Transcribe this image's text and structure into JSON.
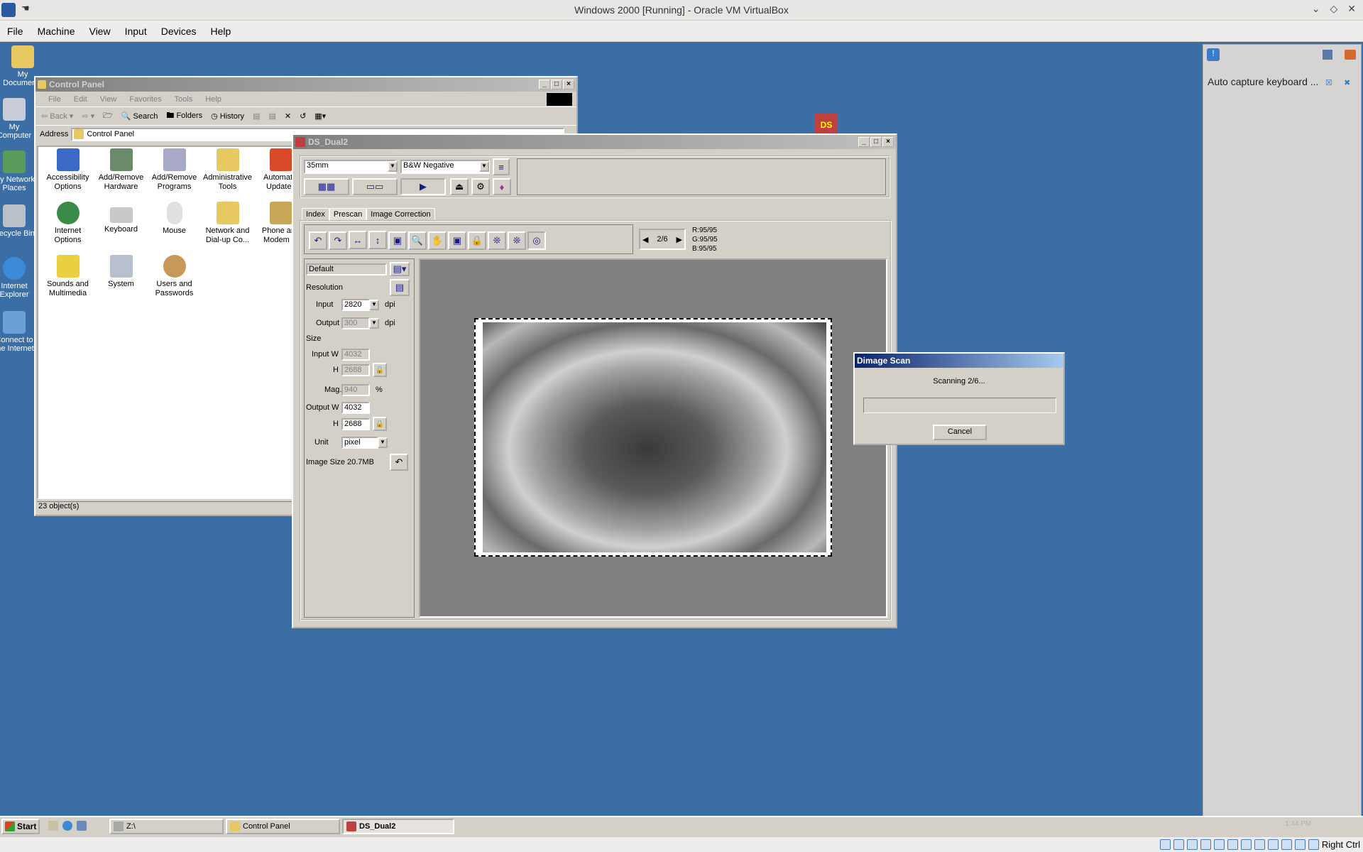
{
  "host": {
    "title": "Windows 2000 [Running] - Oracle VM VirtualBox",
    "menu": [
      "File",
      "Machine",
      "View",
      "Input",
      "Devices",
      "Help"
    ],
    "status_key": "Right Ctrl"
  },
  "side_panel": {
    "notification": "Auto capture keyboard ..."
  },
  "desktop_icons": [
    "My Documents",
    "My Computer",
    "My Network Places",
    "Recycle Bin",
    "Internet Explorer",
    "Connect to the Internet"
  ],
  "control_panel": {
    "title": "Control Panel",
    "menu": [
      "File",
      "Edit",
      "View",
      "Favorites",
      "Tools",
      "Help"
    ],
    "toolbar": {
      "back": "Back",
      "search": "Search",
      "folders": "Folders",
      "history": "History"
    },
    "address_label": "Address",
    "address_value": "Control Panel",
    "items": [
      "Accessibility Options",
      "Add/Remove Hardware",
      "Add/Remove Programs",
      "Administrative Tools",
      "Automatic Updates",
      "Internet Options",
      "Keyboard",
      "Mouse",
      "Network and Dial-up Co...",
      "Phone and Modem ...",
      "Sounds and Multimedia",
      "System",
      "Users and Passwords"
    ],
    "status": "23 object(s)"
  },
  "scanner": {
    "title": "DS_Dual2",
    "film_format": "35mm",
    "film_type": "B&W Negative",
    "tabs": [
      "Index",
      "Prescan",
      "Image Correction"
    ],
    "frame": "2/6",
    "rgb": {
      "r": "R:95/95",
      "g": "G:95/95",
      "b": "B:95/95"
    },
    "preset": "Default",
    "labels": {
      "resolution": "Resolution",
      "input": "Input",
      "output": "Output",
      "dpi": "dpi",
      "size": "Size",
      "input_w": "Input W",
      "h": "H",
      "mag": "Mag.",
      "pct": "%",
      "output_w": "Output W",
      "unit": "Unit",
      "image_size": "Image Size"
    },
    "values": {
      "input_dpi": "2820",
      "output_dpi": "300",
      "input_w": "4032",
      "input_h": "2688",
      "mag": "940",
      "output_w": "4032",
      "output_h": "2688",
      "unit": "pixel",
      "image_size": "20.7MB"
    }
  },
  "dialog": {
    "title": "Dimage Scan",
    "message": "Scanning 2/6...",
    "progress": 0,
    "cancel": "Cancel"
  },
  "taskbar": {
    "start": "Start",
    "tasks": [
      "Z:\\",
      "Control Panel",
      "DS_Dual2"
    ],
    "clock": "1:44 PM"
  }
}
